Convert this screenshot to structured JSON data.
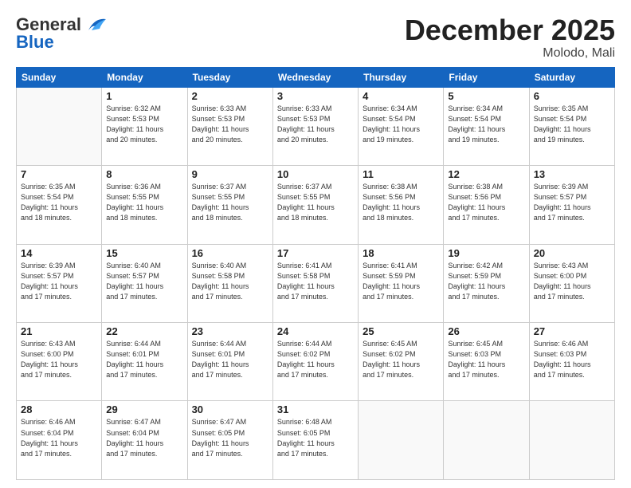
{
  "header": {
    "logo_general": "General",
    "logo_blue": "Blue",
    "month_title": "December 2025",
    "location": "Molodo, Mali"
  },
  "days_of_week": [
    "Sunday",
    "Monday",
    "Tuesday",
    "Wednesday",
    "Thursday",
    "Friday",
    "Saturday"
  ],
  "weeks": [
    [
      {
        "day": "",
        "info": ""
      },
      {
        "day": "1",
        "info": "Sunrise: 6:32 AM\nSunset: 5:53 PM\nDaylight: 11 hours\nand 20 minutes."
      },
      {
        "day": "2",
        "info": "Sunrise: 6:33 AM\nSunset: 5:53 PM\nDaylight: 11 hours\nand 20 minutes."
      },
      {
        "day": "3",
        "info": "Sunrise: 6:33 AM\nSunset: 5:53 PM\nDaylight: 11 hours\nand 20 minutes."
      },
      {
        "day": "4",
        "info": "Sunrise: 6:34 AM\nSunset: 5:54 PM\nDaylight: 11 hours\nand 19 minutes."
      },
      {
        "day": "5",
        "info": "Sunrise: 6:34 AM\nSunset: 5:54 PM\nDaylight: 11 hours\nand 19 minutes."
      },
      {
        "day": "6",
        "info": "Sunrise: 6:35 AM\nSunset: 5:54 PM\nDaylight: 11 hours\nand 19 minutes."
      }
    ],
    [
      {
        "day": "7",
        "info": "Sunrise: 6:35 AM\nSunset: 5:54 PM\nDaylight: 11 hours\nand 18 minutes."
      },
      {
        "day": "8",
        "info": "Sunrise: 6:36 AM\nSunset: 5:55 PM\nDaylight: 11 hours\nand 18 minutes."
      },
      {
        "day": "9",
        "info": "Sunrise: 6:37 AM\nSunset: 5:55 PM\nDaylight: 11 hours\nand 18 minutes."
      },
      {
        "day": "10",
        "info": "Sunrise: 6:37 AM\nSunset: 5:55 PM\nDaylight: 11 hours\nand 18 minutes."
      },
      {
        "day": "11",
        "info": "Sunrise: 6:38 AM\nSunset: 5:56 PM\nDaylight: 11 hours\nand 18 minutes."
      },
      {
        "day": "12",
        "info": "Sunrise: 6:38 AM\nSunset: 5:56 PM\nDaylight: 11 hours\nand 17 minutes."
      },
      {
        "day": "13",
        "info": "Sunrise: 6:39 AM\nSunset: 5:57 PM\nDaylight: 11 hours\nand 17 minutes."
      }
    ],
    [
      {
        "day": "14",
        "info": "Sunrise: 6:39 AM\nSunset: 5:57 PM\nDaylight: 11 hours\nand 17 minutes."
      },
      {
        "day": "15",
        "info": "Sunrise: 6:40 AM\nSunset: 5:57 PM\nDaylight: 11 hours\nand 17 minutes."
      },
      {
        "day": "16",
        "info": "Sunrise: 6:40 AM\nSunset: 5:58 PM\nDaylight: 11 hours\nand 17 minutes."
      },
      {
        "day": "17",
        "info": "Sunrise: 6:41 AM\nSunset: 5:58 PM\nDaylight: 11 hours\nand 17 minutes."
      },
      {
        "day": "18",
        "info": "Sunrise: 6:41 AM\nSunset: 5:59 PM\nDaylight: 11 hours\nand 17 minutes."
      },
      {
        "day": "19",
        "info": "Sunrise: 6:42 AM\nSunset: 5:59 PM\nDaylight: 11 hours\nand 17 minutes."
      },
      {
        "day": "20",
        "info": "Sunrise: 6:43 AM\nSunset: 6:00 PM\nDaylight: 11 hours\nand 17 minutes."
      }
    ],
    [
      {
        "day": "21",
        "info": "Sunrise: 6:43 AM\nSunset: 6:00 PM\nDaylight: 11 hours\nand 17 minutes."
      },
      {
        "day": "22",
        "info": "Sunrise: 6:44 AM\nSunset: 6:01 PM\nDaylight: 11 hours\nand 17 minutes."
      },
      {
        "day": "23",
        "info": "Sunrise: 6:44 AM\nSunset: 6:01 PM\nDaylight: 11 hours\nand 17 minutes."
      },
      {
        "day": "24",
        "info": "Sunrise: 6:44 AM\nSunset: 6:02 PM\nDaylight: 11 hours\nand 17 minutes."
      },
      {
        "day": "25",
        "info": "Sunrise: 6:45 AM\nSunset: 6:02 PM\nDaylight: 11 hours\nand 17 minutes."
      },
      {
        "day": "26",
        "info": "Sunrise: 6:45 AM\nSunset: 6:03 PM\nDaylight: 11 hours\nand 17 minutes."
      },
      {
        "day": "27",
        "info": "Sunrise: 6:46 AM\nSunset: 6:03 PM\nDaylight: 11 hours\nand 17 minutes."
      }
    ],
    [
      {
        "day": "28",
        "info": "Sunrise: 6:46 AM\nSunset: 6:04 PM\nDaylight: 11 hours\nand 17 minutes."
      },
      {
        "day": "29",
        "info": "Sunrise: 6:47 AM\nSunset: 6:04 PM\nDaylight: 11 hours\nand 17 minutes."
      },
      {
        "day": "30",
        "info": "Sunrise: 6:47 AM\nSunset: 6:05 PM\nDaylight: 11 hours\nand 17 minutes."
      },
      {
        "day": "31",
        "info": "Sunrise: 6:48 AM\nSunset: 6:05 PM\nDaylight: 11 hours\nand 17 minutes."
      },
      {
        "day": "",
        "info": ""
      },
      {
        "day": "",
        "info": ""
      },
      {
        "day": "",
        "info": ""
      }
    ]
  ]
}
